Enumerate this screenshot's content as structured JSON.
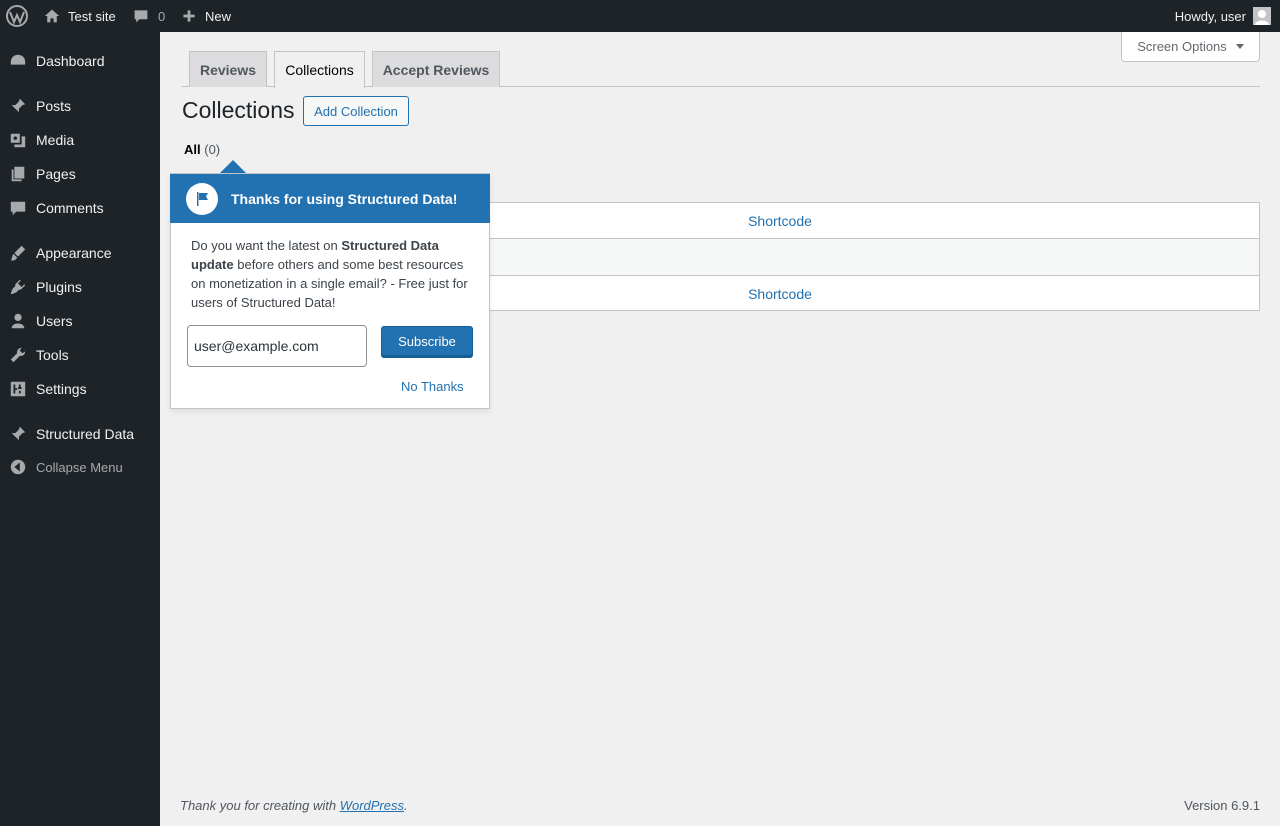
{
  "adminbar": {
    "site_name": "Test site",
    "comments_count": "0",
    "new_label": "New",
    "howdy": "Howdy, user"
  },
  "sidebar": {
    "items": [
      {
        "label": "Dashboard",
        "icon": "dashboard-icon"
      },
      {
        "label": "Posts",
        "icon": "pin-icon"
      },
      {
        "label": "Media",
        "icon": "media-icon"
      },
      {
        "label": "Pages",
        "icon": "pages-icon"
      },
      {
        "label": "Comments",
        "icon": "comment-icon"
      },
      {
        "label": "Appearance",
        "icon": "brush-icon"
      },
      {
        "label": "Plugins",
        "icon": "plugin-icon"
      },
      {
        "label": "Users",
        "icon": "user-icon"
      },
      {
        "label": "Tools",
        "icon": "wrench-icon"
      },
      {
        "label": "Settings",
        "icon": "settings-icon"
      },
      {
        "label": "Structured Data",
        "icon": "pin-icon"
      }
    ],
    "collapse_label": "Collapse Menu"
  },
  "screen_options": "Screen Options",
  "tabs": [
    {
      "label": "Reviews",
      "active": false
    },
    {
      "label": "Collections",
      "active": true
    },
    {
      "label": "Accept Reviews",
      "active": false
    }
  ],
  "page": {
    "title": "Collections",
    "add_button": "Add Collection",
    "filter_label": "All",
    "filter_count": "(0)"
  },
  "table": {
    "header_col": "Shortcode",
    "footer_col": "Shortcode"
  },
  "pointer": {
    "title": "Thanks for using Structured Data!",
    "body_pre": "Do you want the latest on ",
    "body_bold1": "Structured Data update",
    "body_post": " before others and some best resources on monetization in a single email? - Free just for users of Structured Data!",
    "email_value": "user@example.com",
    "subscribe_label": "Subscribe",
    "no_thanks_label": "No Thanks"
  },
  "footer": {
    "thanks_pre": "Thank you for creating with ",
    "wp_link": "WordPress",
    "thanks_post": ".",
    "version": "Version 6.9.1"
  }
}
